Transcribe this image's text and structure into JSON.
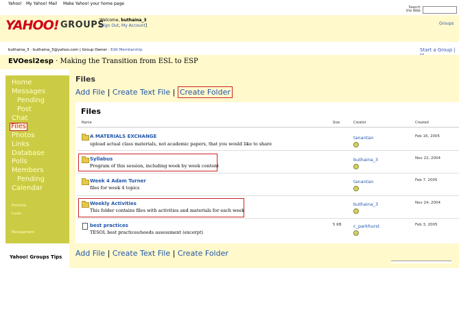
{
  "topnav": {
    "links": [
      "Yahoo!",
      "My Yahoo!",
      "Mail",
      "Make Yahoo! your home page"
    ],
    "search_label_1": "Search",
    "search_label_2": "the Web"
  },
  "header": {
    "logo": "YAHOO!",
    "groups_word": "GROUPS",
    "welcome": "Welcome,",
    "username": "buthaina_3",
    "sign_out": "Sign Out",
    "my_account": "My Account",
    "groups_link": "Groups"
  },
  "membership": {
    "text": "buthaina_3 · buthaina_3@yahoo.com | Group Owner ·",
    "edit": "Edit Membership",
    "start_group": "Start a Group | M"
  },
  "group": {
    "id": "EVOesl2esp",
    "title": " · Making the Transition from ESL to ESP"
  },
  "sidebar": {
    "items": [
      {
        "label": "Home",
        "sub": false
      },
      {
        "label": "Messages",
        "sub": false
      },
      {
        "label": "Pending",
        "sub": true
      },
      {
        "label": "Post",
        "sub": true
      },
      {
        "label": "Chat",
        "sub": false
      },
      {
        "label": "Files",
        "sub": false,
        "active": true
      },
      {
        "label": "Photos",
        "sub": false
      },
      {
        "label": "Links",
        "sub": false
      },
      {
        "label": "Database",
        "sub": false
      },
      {
        "label": "Polls",
        "sub": false
      },
      {
        "label": "Members",
        "sub": false
      },
      {
        "label": "Pending",
        "sub": true
      },
      {
        "label": "Calendar",
        "sub": false
      }
    ],
    "promote": "Promote",
    "invite": "Invite",
    "management": "Management",
    "tips": "Yahoo! Groups Tips"
  },
  "main": {
    "heading": "Files",
    "add_file": "Add File",
    "create_text_file": "Create Text File",
    "create_folder": "Create Folder",
    "separator": "|",
    "panel_title": "Files",
    "columns": {
      "name": "Name",
      "size": "Size",
      "creator": "Creator",
      "created": "Created"
    },
    "rows": [
      {
        "name": "A MATERIALS EXCHANGE",
        "desc": "upload actual class materials, not academic papers, that you would like to share",
        "size": "",
        "creator": "tanantan",
        "created": "Feb 16, 2005",
        "type": "folder"
      },
      {
        "name": "Syllabus",
        "desc": "Program of this session, including week by week content",
        "size": "",
        "creator": "buthaina_3",
        "created": "Nov 22, 2004",
        "type": "folder"
      },
      {
        "name": "Week 4 Adam Turner",
        "desc": "files for week 4 topics",
        "size": "",
        "creator": "tanantan",
        "created": "Feb 7, 2005",
        "type": "folder"
      },
      {
        "name": "Weekly Activities",
        "desc": "This folder contains files with activities and materials for each week",
        "size": "",
        "creator": "buthaina_3",
        "created": "Nov 24, 2004",
        "type": "folder"
      },
      {
        "name": "best practices",
        "desc": "TESOL best practices/needs assessment (excerpt)",
        "size": "5 KB",
        "creator": "c_parkhurst",
        "created": "Feb 3, 2005",
        "type": "file"
      }
    ]
  },
  "colors": {
    "accent": "#cccc44",
    "link": "#2255aa",
    "highlight": "#cc2222",
    "header_bg": "#fff9cc",
    "logo": "#d0021b"
  }
}
